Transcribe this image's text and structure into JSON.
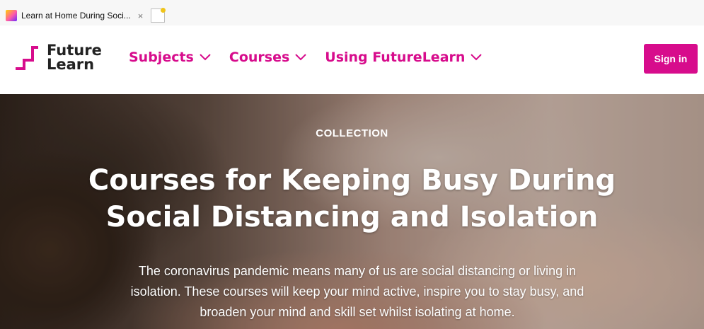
{
  "browser": {
    "tab_title": "Learn at Home During Soci...",
    "close_glyph": "×",
    "favicon": "futurelearn-favicon",
    "new_tab_icon": "new-tab-icon"
  },
  "header": {
    "logo": {
      "line1": "Future",
      "line2": "Learn",
      "icon": "futurelearn-logo-icon"
    },
    "nav": [
      {
        "label": "Subjects",
        "icon": "chevron-down-icon"
      },
      {
        "label": "Courses",
        "icon": "chevron-down-icon"
      },
      {
        "label": "Using FutureLearn",
        "icon": "chevron-down-icon"
      }
    ],
    "sign_in": "Sign in"
  },
  "hero": {
    "overline": "COLLECTION",
    "title": "Courses for Keeping Busy During Social Distancing and Isolation",
    "description": "The coronavirus pandemic means many of us are social distancing or living in isolation. These courses will keep your mind active, inspire you to stay busy, and broaden your mind and skill set whilst isolating at home."
  },
  "colors": {
    "brand": "#d70c8c",
    "text_dark": "#222222",
    "hero_text": "#ffffff"
  }
}
